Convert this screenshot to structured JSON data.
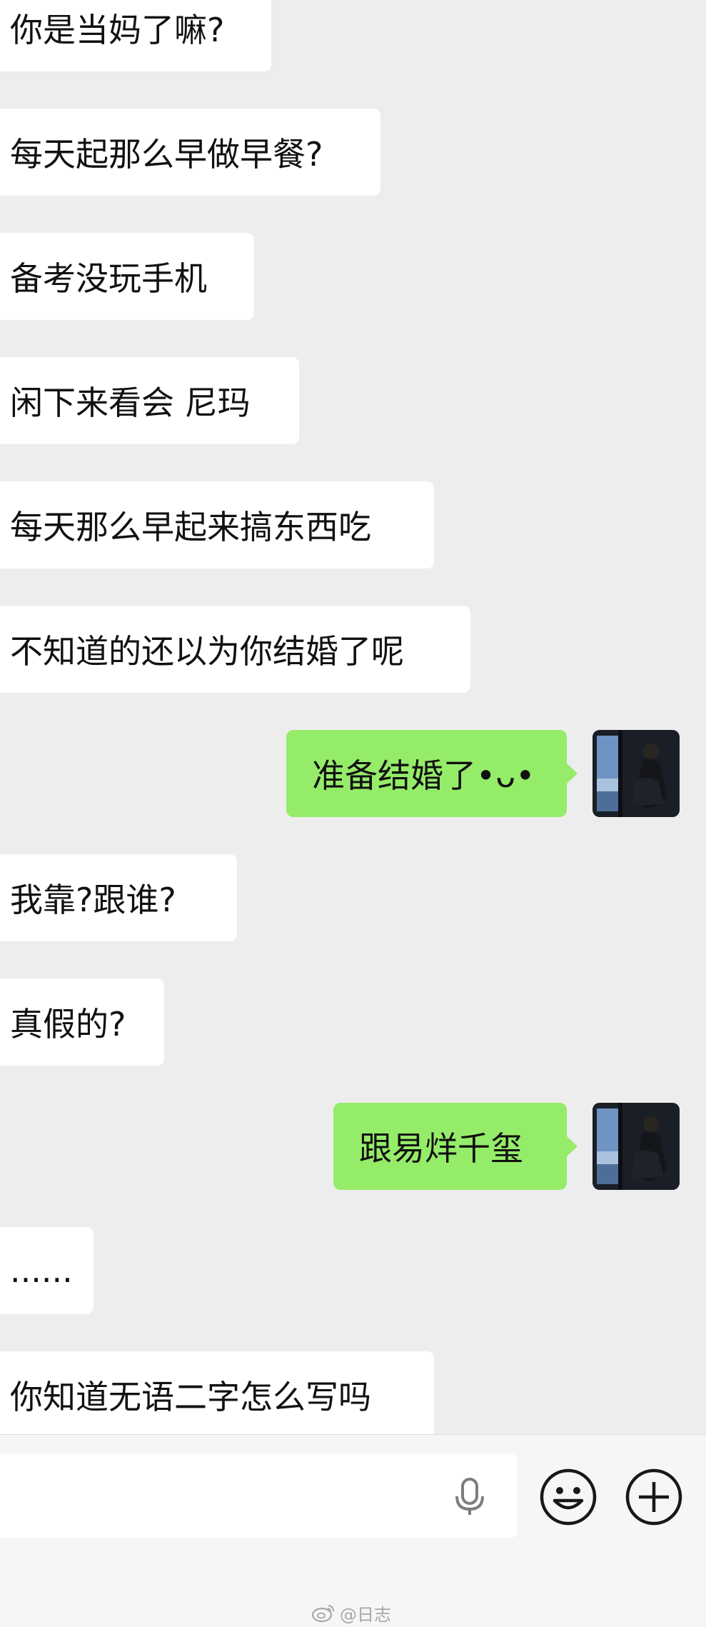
{
  "messages": [
    {
      "side": "left",
      "text": "你是当妈了嘛?"
    },
    {
      "side": "left",
      "text": "每天起那么早做早餐?"
    },
    {
      "side": "left",
      "text": "备考没玩手机"
    },
    {
      "side": "left",
      "text": "闲下来看会 尼玛"
    },
    {
      "side": "left",
      "text": "每天那么早起来搞东西吃"
    },
    {
      "side": "left",
      "text": "不知道的还以为你结婚了呢"
    },
    {
      "side": "right",
      "text": "准备结婚了•ᴗ•"
    },
    {
      "side": "left",
      "text": "我靠?跟谁?"
    },
    {
      "side": "left",
      "text": "真假的?"
    },
    {
      "side": "right",
      "text": "跟易烊千玺"
    },
    {
      "side": "left",
      "text": "......"
    },
    {
      "side": "left",
      "text": "你知道无语二字怎么写吗"
    }
  ],
  "input": {
    "value": "",
    "placeholder": ""
  },
  "icons": {
    "voice": "microphone-icon",
    "emoji": "smiley-icon",
    "more": "plus-circle-icon",
    "watermark": "weibo-icon"
  },
  "watermark": {
    "text": "@日志"
  },
  "colors": {
    "background": "#ededed",
    "incoming_bubble": "#ffffff",
    "outgoing_bubble": "#95ec69",
    "input_bar": "#f6f6f6"
  }
}
